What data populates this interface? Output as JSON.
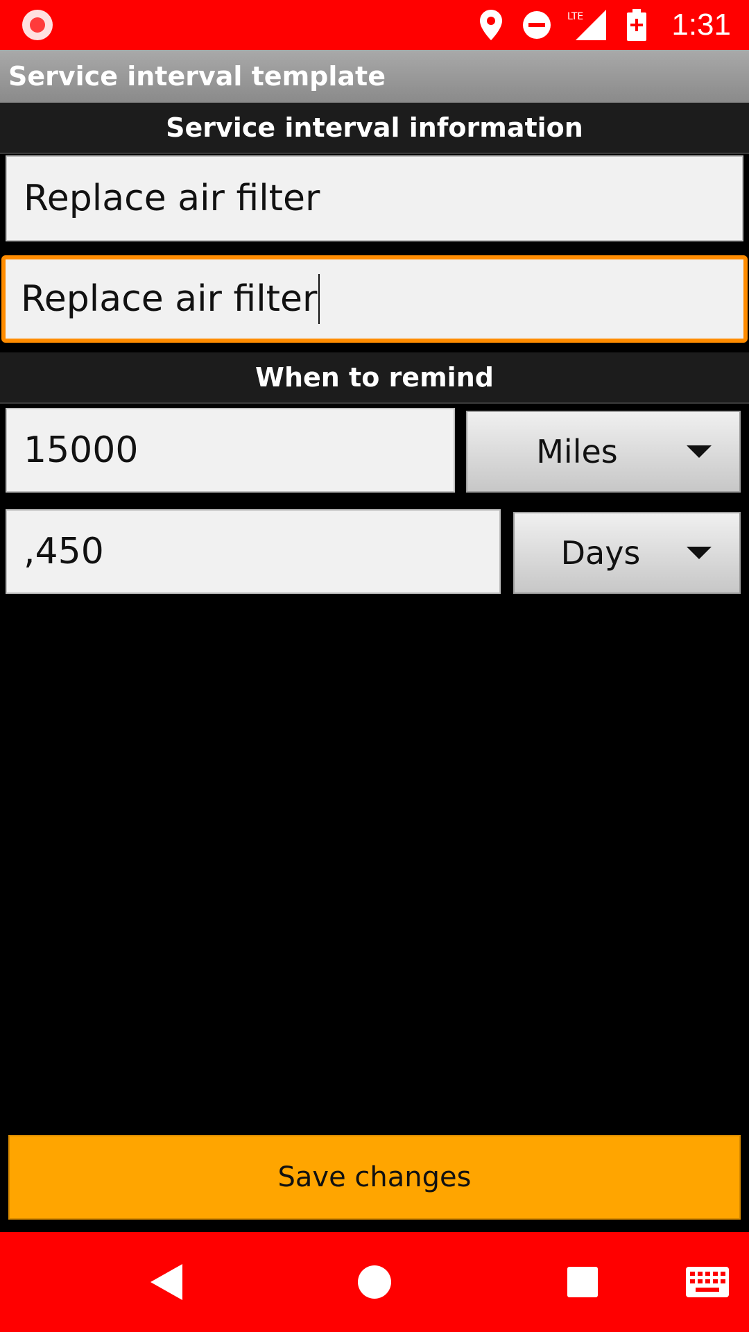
{
  "status_bar": {
    "time": "1:31",
    "network": "LTE",
    "icons": [
      "record-icon",
      "location-icon",
      "do-not-disturb-icon",
      "lte-signal-icon",
      "battery-charging-icon"
    ]
  },
  "title_bar": {
    "title": "Service interval template"
  },
  "sections": {
    "info_header": "Service interval information",
    "remind_header": "When to remind"
  },
  "fields": {
    "name_value": "Replace air filter",
    "description_value": "Replace air filter",
    "distance_value": "15000",
    "time_value": ",450"
  },
  "spinners": {
    "distance_unit": "Miles",
    "time_unit": "Days"
  },
  "actions": {
    "save_label": "Save changes"
  },
  "colors": {
    "status_bar": "#ff0000",
    "accent_focus": "#ff8c00",
    "save_button": "#ffa500",
    "background": "#000000"
  },
  "nav_bar": {
    "icons": [
      "back-icon",
      "home-icon",
      "recents-icon",
      "keyboard-icon"
    ]
  }
}
